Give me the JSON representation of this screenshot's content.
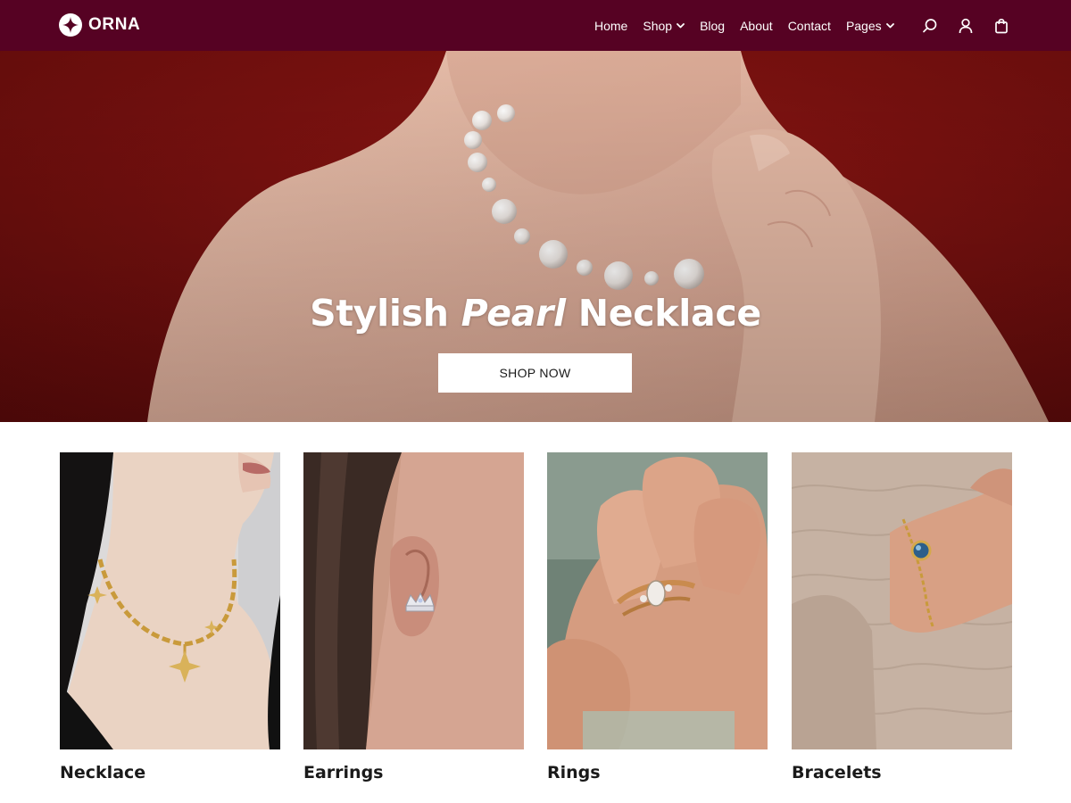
{
  "brand": {
    "name": "ORNA",
    "color": "#560223"
  },
  "nav": {
    "items": [
      {
        "label": "Home",
        "has_dropdown": false
      },
      {
        "label": "Shop",
        "has_dropdown": true
      },
      {
        "label": "Blog",
        "has_dropdown": false
      },
      {
        "label": "About",
        "has_dropdown": false
      },
      {
        "label": "Contact",
        "has_dropdown": false
      },
      {
        "label": "Pages",
        "has_dropdown": true
      }
    ],
    "icons": [
      "search-icon",
      "user-icon",
      "shopping-bag-icon"
    ]
  },
  "hero": {
    "title_part1": "Stylish ",
    "title_emphasis": "Pearl",
    "title_part2": " Necklace",
    "cta_label": "SHOP NOW",
    "background_color": "#6a0e0e"
  },
  "categories": [
    {
      "label": "Necklace"
    },
    {
      "label": "Earrings"
    },
    {
      "label": "Rings"
    },
    {
      "label": "Bracelets"
    }
  ]
}
